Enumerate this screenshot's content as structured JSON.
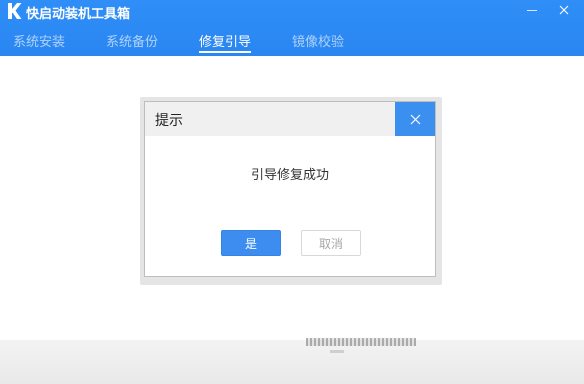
{
  "app": {
    "title": "快启动装机工具箱"
  },
  "tabs": [
    {
      "label": "系统安装",
      "active": false
    },
    {
      "label": "系统备份",
      "active": false
    },
    {
      "label": "修复引导",
      "active": true
    },
    {
      "label": "镜像校验",
      "active": false
    }
  ],
  "dialog": {
    "title": "提示",
    "message": "引导修复成功",
    "ok_label": "是",
    "cancel_label": "取消"
  },
  "icons": {
    "logo": "k-logo-icon",
    "minimize": "minimize-icon",
    "close": "close-icon",
    "dialog_close": "dialog-close-icon"
  },
  "colors": {
    "header_blue": "#2f8ef7",
    "primary_button": "#3d8df0",
    "dialog_close_bg": "#3a8fef"
  }
}
